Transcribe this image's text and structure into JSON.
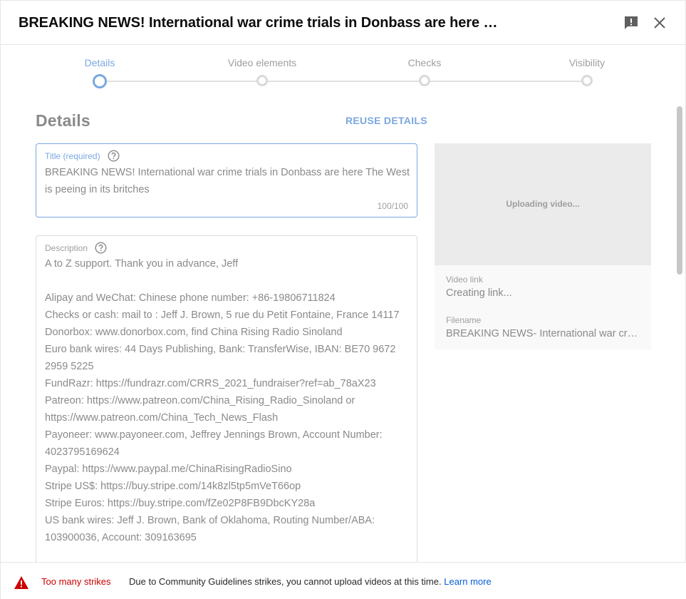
{
  "header": {
    "title": "BREAKING NEWS! International war crime trials in Donbass are here The West is peeing in its britches"
  },
  "stepper": {
    "steps": [
      {
        "label": "Details",
        "active": true
      },
      {
        "label": "Video elements",
        "active": false
      },
      {
        "label": "Checks",
        "active": false
      },
      {
        "label": "Visibility",
        "active": false
      }
    ]
  },
  "details": {
    "section_title": "Details",
    "reuse_label": "REUSE DETAILS",
    "title_field": {
      "label": "Title (required)",
      "value": "BREAKING NEWS! International war crime trials in Donbass are here The West is peeing in its britches",
      "count": "100/100"
    },
    "description_field": {
      "label": "Description",
      "value": "A to Z support. Thank you in advance, Jeff\n\nAlipay and WeChat: Chinese phone number: +86-19806711824\nChecks or cash: mail to : Jeff J. Brown, 5 rue du Petit Fontaine, France 14117\nDonorbox: www.donorbox.com, find China Rising Radio Sinoland\nEuro bank wires: 44 Days Publishing, Bank: TransferWise, IBAN: BE70 9672 2959 5225\nFundRazr: https://fundrazr.com/CRRS_2021_fundraiser?ref=ab_78aX23\nPatreon: https://www.patreon.com/China_Rising_Radio_Sinoland or https://www.patreon.com/China_Tech_News_Flash\nPayoneer: www.payoneer.com, Jeffrey Jennings Brown, Account Number: 4023795169624\nPaypal: https://www.paypal.me/ChinaRisingRadioSino\nStripe US$: https://buy.stripe.com/14k8zl5tp5mVeT66op\nStripe Euros: https://buy.stripe.com/fZe02P8FB9DbcKY28a\nUS bank wires: Jeff J. Brown, Bank of Oklahoma, Routing Number/ABA: 103900036, Account: 309163695"
    }
  },
  "preview": {
    "status": "Uploading video...",
    "video_link_label": "Video link",
    "video_link_value": "Creating link...",
    "filename_label": "Filename",
    "filename_value": "BREAKING NEWS- International war crime trials in Donbass are here The West is peeing in its britches"
  },
  "footer": {
    "strikes_label": "Too many strikes",
    "message": "Due to Community Guidelines strikes, you cannot upload videos at this time.",
    "learn_more": "Learn more"
  },
  "colors": {
    "accent": "#7aa7e0",
    "error": "#cc0000",
    "link": "#065fd4"
  },
  "icons": {
    "feedback": "feedback-icon",
    "close": "close-icon",
    "help": "help-icon",
    "warning": "warning-icon"
  }
}
